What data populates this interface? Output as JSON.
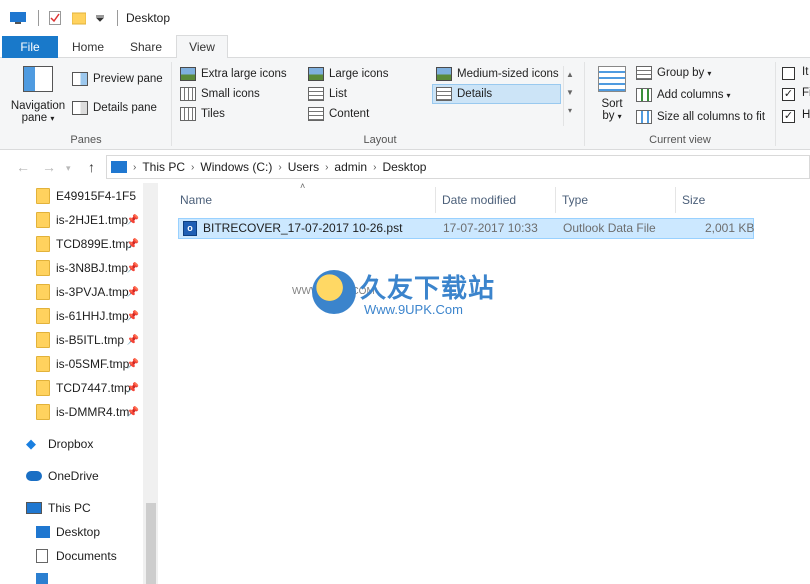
{
  "window": {
    "title": "Desktop"
  },
  "tabs": [
    {
      "label": "File"
    },
    {
      "label": "Home"
    },
    {
      "label": "Share"
    },
    {
      "label": "View"
    }
  ],
  "ribbon": {
    "panes": {
      "navigation_pane_line1": "Navigation",
      "navigation_pane_line2": "pane",
      "preview_pane": "Preview pane",
      "details_pane": "Details pane",
      "group_label": "Panes"
    },
    "layout": {
      "items": [
        "Extra large icons",
        "Large icons",
        "Medium-sized icons",
        "Small icons",
        "List",
        "Details",
        "Tiles",
        "Content"
      ],
      "selected": "Details",
      "group_label": "Layout"
    },
    "current_view": {
      "sort_line1": "Sort",
      "sort_line2": "by",
      "group_by": "Group by",
      "add_columns": "Add columns",
      "size_all_columns": "Size all columns to fit",
      "group_label": "Current view"
    },
    "show_hide": {
      "items": [
        "It",
        "Fi",
        "H"
      ],
      "checked": [
        false,
        true,
        true
      ]
    }
  },
  "address": {
    "crumbs": [
      "This PC",
      "Windows (C:)",
      "Users",
      "admin",
      "Desktop"
    ]
  },
  "nav_pane": {
    "quick_items": [
      "E49915F4-1F5",
      "is-2HJE1.tmp",
      "TCD899E.tmp",
      "is-3N8BJ.tmp",
      "is-3PVJA.tmp",
      "is-61HHJ.tmp",
      "is-B5ITL.tmp",
      "is-05SMF.tmp",
      "TCD7447.tmp",
      "is-DMMR4.tm"
    ],
    "dropbox": "Dropbox",
    "onedrive": "OneDrive",
    "this_pc": "This PC",
    "desktop": "Desktop",
    "documents": "Documents"
  },
  "columns": {
    "name": "Name",
    "date_modified": "Date modified",
    "type": "Type",
    "size": "Size"
  },
  "files": [
    {
      "name": "BITRECOVER_17-07-2017 10-26.pst",
      "date": "17-07-2017 10:33",
      "type": "Outlook Data File",
      "size": "2,001 KB"
    }
  ],
  "watermark": {
    "cn": "久友下载站",
    "url": "Www.9UPK.Com",
    "small": "WWW.9UPK.COM"
  },
  "colors": {
    "accent": "#1979ca",
    "selection": "#cce8ff"
  }
}
